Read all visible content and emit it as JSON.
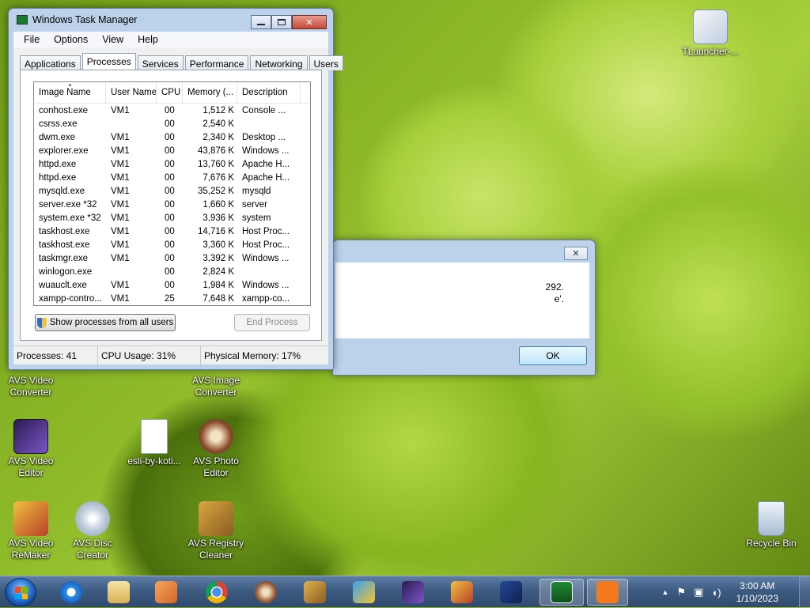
{
  "desktop": {
    "icons": [
      {
        "label1": "TLauncher-...",
        "label2": ""
      },
      {
        "label1": "AVS Video",
        "label2": "Converter"
      },
      {
        "label1": "AVS Image",
        "label2": "Converter"
      },
      {
        "label1": "AVS Video",
        "label2": "Editor"
      },
      {
        "label1": "esli-by-koti...",
        "label2": ""
      },
      {
        "label1": "AVS Photo",
        "label2": "Editor"
      },
      {
        "label1": "AVS Video",
        "label2": "ReMaker"
      },
      {
        "label1": "AVS Disc",
        "label2": "Creator"
      },
      {
        "label1": "AVS Registry",
        "label2": "Cleaner"
      },
      {
        "label1": "Recycle Bin",
        "label2": ""
      }
    ]
  },
  "task_manager": {
    "title": "Windows Task Manager",
    "menu": [
      "File",
      "Options",
      "View",
      "Help"
    ],
    "tabs": [
      "Applications",
      "Processes",
      "Services",
      "Performance",
      "Networking",
      "Users"
    ],
    "active_tab": "Processes",
    "columns": [
      "Image Name",
      "User Name",
      "CPU",
      "Memory (...",
      "Description"
    ],
    "rows": [
      [
        "conhost.exe",
        "VM1",
        "00",
        "1,512 K",
        "Console ..."
      ],
      [
        "csrss.exe",
        "",
        "00",
        "2,540 K",
        ""
      ],
      [
        "dwm.exe",
        "VM1",
        "00",
        "2,340 K",
        "Desktop ..."
      ],
      [
        "explorer.exe",
        "VM1",
        "00",
        "43,876 K",
        "Windows ..."
      ],
      [
        "httpd.exe",
        "VM1",
        "00",
        "13,760 K",
        "Apache H..."
      ],
      [
        "httpd.exe",
        "VM1",
        "00",
        "7,676 K",
        "Apache H..."
      ],
      [
        "mysqld.exe",
        "VM1",
        "00",
        "35,252 K",
        "mysqld"
      ],
      [
        "server.exe *32",
        "VM1",
        "00",
        "1,660 K",
        "server"
      ],
      [
        "system.exe *32",
        "VM1",
        "00",
        "3,936 K",
        "system"
      ],
      [
        "taskhost.exe",
        "VM1",
        "00",
        "14,716 K",
        "Host Proc..."
      ],
      [
        "taskhost.exe",
        "VM1",
        "00",
        "3,360 K",
        "Host Proc..."
      ],
      [
        "taskmgr.exe",
        "VM1",
        "00",
        "3,392 K",
        "Windows ..."
      ],
      [
        "winlogon.exe",
        "",
        "00",
        "2,824 K",
        ""
      ],
      [
        "wuauclt.exe",
        "VM1",
        "00",
        "1,984 K",
        "Windows ..."
      ],
      [
        "xampp-contro...",
        "VM1",
        "25",
        "7,648 K",
        "xampp-co..."
      ]
    ],
    "show_all_button": "Show processes from all users",
    "end_process_button": "End Process",
    "status": {
      "processes": "Processes: 41",
      "cpu": "CPU Usage: 31%",
      "memory": "Physical Memory: 17%"
    }
  },
  "dialog": {
    "line1": "292.",
    "line2": "e'.",
    "close_glyph": "✕",
    "ok_label": "OK"
  },
  "taskbar": {
    "clock_time": "3:00 AM",
    "clock_date": "1/10/2023",
    "tray_expand": "▲"
  }
}
